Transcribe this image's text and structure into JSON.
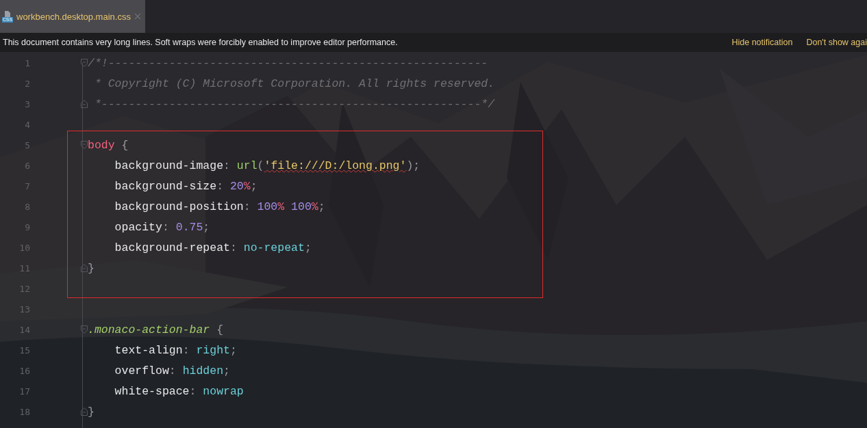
{
  "tab": {
    "title": "workbench.desktop.main.css",
    "selected": true,
    "icon_label": "CSS"
  },
  "notification": {
    "message": "This document contains very long lines. Soft wraps were forcibly enabled to improve editor performance.",
    "actions": [
      "Hide notification",
      "Don't show agai"
    ]
  },
  "sections": [
    {
      "highlighted": false,
      "lines": [
        {
          "number": "1",
          "kind": "opener",
          "tokens": [
            {
              "kind": "comment",
              "text": "/*!--------------------------------------------------------"
            }
          ]
        },
        {
          "number": "2",
          "kind": "plain",
          "tokens": [
            {
              "kind": "comment",
              "text": " * Copyright (C) Microsoft Corporation. All rights reserved."
            }
          ]
        },
        {
          "number": "3",
          "kind": "closer",
          "tokens": [
            {
              "kind": "comment",
              "text": " *--------------------------------------------------------*/"
            }
          ]
        },
        {
          "number": "4",
          "kind": "plain"
        }
      ]
    },
    {
      "highlighted": true,
      "lines": [
        {
          "number": "5",
          "kind": "opener",
          "tokens": [
            {
              "kind": "selector",
              "text": "body"
            },
            {
              "kind": "punct",
              "text": " {"
            }
          ]
        },
        {
          "number": "6",
          "kind": "plain",
          "tokens": [
            {
              "kind": "property",
              "text": "    background-image"
            },
            {
              "kind": "punct",
              "text": ": "
            },
            {
              "kind": "func",
              "text": "url"
            },
            {
              "kind": "punct",
              "text": "("
            },
            {
              "kind": "string",
              "text": "'file:///D:/long.png'"
            },
            {
              "kind": "punct",
              "text": ");"
            }
          ]
        },
        {
          "number": "7",
          "kind": "plain",
          "tokens": [
            {
              "kind": "property",
              "text": "    background-size"
            },
            {
              "kind": "punct",
              "text": ": "
            },
            {
              "kind": "number",
              "text": "20"
            },
            {
              "kind": "unit",
              "text": "%"
            },
            {
              "kind": "punct",
              "text": ";"
            }
          ]
        },
        {
          "number": "8",
          "kind": "plain",
          "tokens": [
            {
              "kind": "property",
              "text": "    background-position"
            },
            {
              "kind": "punct",
              "text": ": "
            },
            {
              "kind": "number",
              "text": "100"
            },
            {
              "kind": "unit",
              "text": "%"
            },
            {
              "kind": "number",
              "text": " 100"
            },
            {
              "kind": "unit",
              "text": "%"
            },
            {
              "kind": "punct",
              "text": ";"
            }
          ]
        },
        {
          "number": "9",
          "kind": "plain",
          "tokens": [
            {
              "kind": "property",
              "text": "    opacity"
            },
            {
              "kind": "punct",
              "text": ": "
            },
            {
              "kind": "number",
              "text": "0.75"
            },
            {
              "kind": "punct",
              "text": ";"
            }
          ]
        },
        {
          "number": "10",
          "kind": "plain",
          "tokens": [
            {
              "kind": "property",
              "text": "    background-repeat"
            },
            {
              "kind": "punct",
              "text": ": "
            },
            {
              "kind": "keyword",
              "text": "no-repeat"
            },
            {
              "kind": "punct",
              "text": ";"
            }
          ]
        },
        {
          "number": "11",
          "kind": "closer",
          "tokens": [
            {
              "kind": "punct",
              "text": "}"
            }
          ]
        },
        {
          "number": "12",
          "kind": "plain"
        }
      ]
    },
    {
      "highlighted": false,
      "lines": [
        {
          "number": "13",
          "kind": "plain"
        },
        {
          "number": "14",
          "kind": "opener",
          "tokens": [
            {
              "kind": "class",
              "text": ".monaco-action-bar"
            },
            {
              "kind": "punct",
              "text": " {"
            }
          ]
        },
        {
          "number": "15",
          "kind": "plain",
          "tokens": [
            {
              "kind": "property",
              "text": "    text-align"
            },
            {
              "kind": "punct",
              "text": ": "
            },
            {
              "kind": "keyword",
              "text": "right"
            },
            {
              "kind": "punct",
              "text": ";"
            }
          ]
        },
        {
          "number": "16",
          "kind": "plain",
          "tokens": [
            {
              "kind": "property",
              "text": "    overflow"
            },
            {
              "kind": "punct",
              "text": ": "
            },
            {
              "kind": "keyword",
              "text": "hidden"
            },
            {
              "kind": "punct",
              "text": ";"
            }
          ]
        },
        {
          "number": "17",
          "kind": "plain",
          "tokens": [
            {
              "kind": "property",
              "text": "    white-space"
            },
            {
              "kind": "punct",
              "text": ": "
            },
            {
              "kind": "keyword",
              "text": "nowrap"
            }
          ]
        },
        {
          "number": "18",
          "kind": "closer",
          "tokens": [
            {
              "kind": "punct",
              "text": "}"
            }
          ]
        }
      ]
    }
  ]
}
